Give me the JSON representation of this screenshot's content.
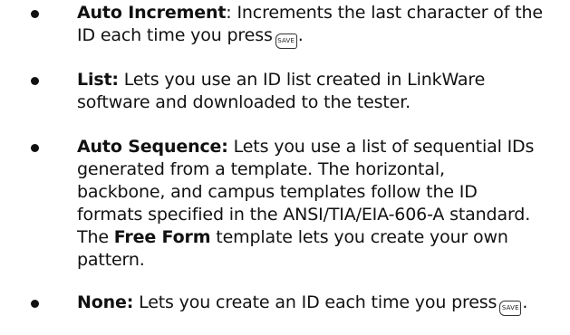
{
  "items": [
    {
      "bold": "Auto Increment",
      "lines": [
        ": Increments the last character of the",
        "ID each time you press",
        "."
      ]
    },
    {
      "bold": "List:",
      "lines": [
        " Lets you use an ID list created in LinkWare",
        "software and downloaded to the tester."
      ]
    },
    {
      "bold": "Auto Sequence:",
      "lines": [
        " Lets you use a list of sequential IDs",
        "generated from a template. The horizontal,",
        "backbone, and campus templates follow the ID",
        "formats specified in the ANSI/TIA/EIA-606-A standard.",
        "The ",
        "Free Form",
        " template lets you create your own",
        "pattern."
      ]
    },
    {
      "bold": "None:",
      "lines": [
        " Lets you create an ID each time you press",
        "."
      ]
    }
  ],
  "save_key_label": "SAVE",
  "save_key_icon": "save-key-icon"
}
